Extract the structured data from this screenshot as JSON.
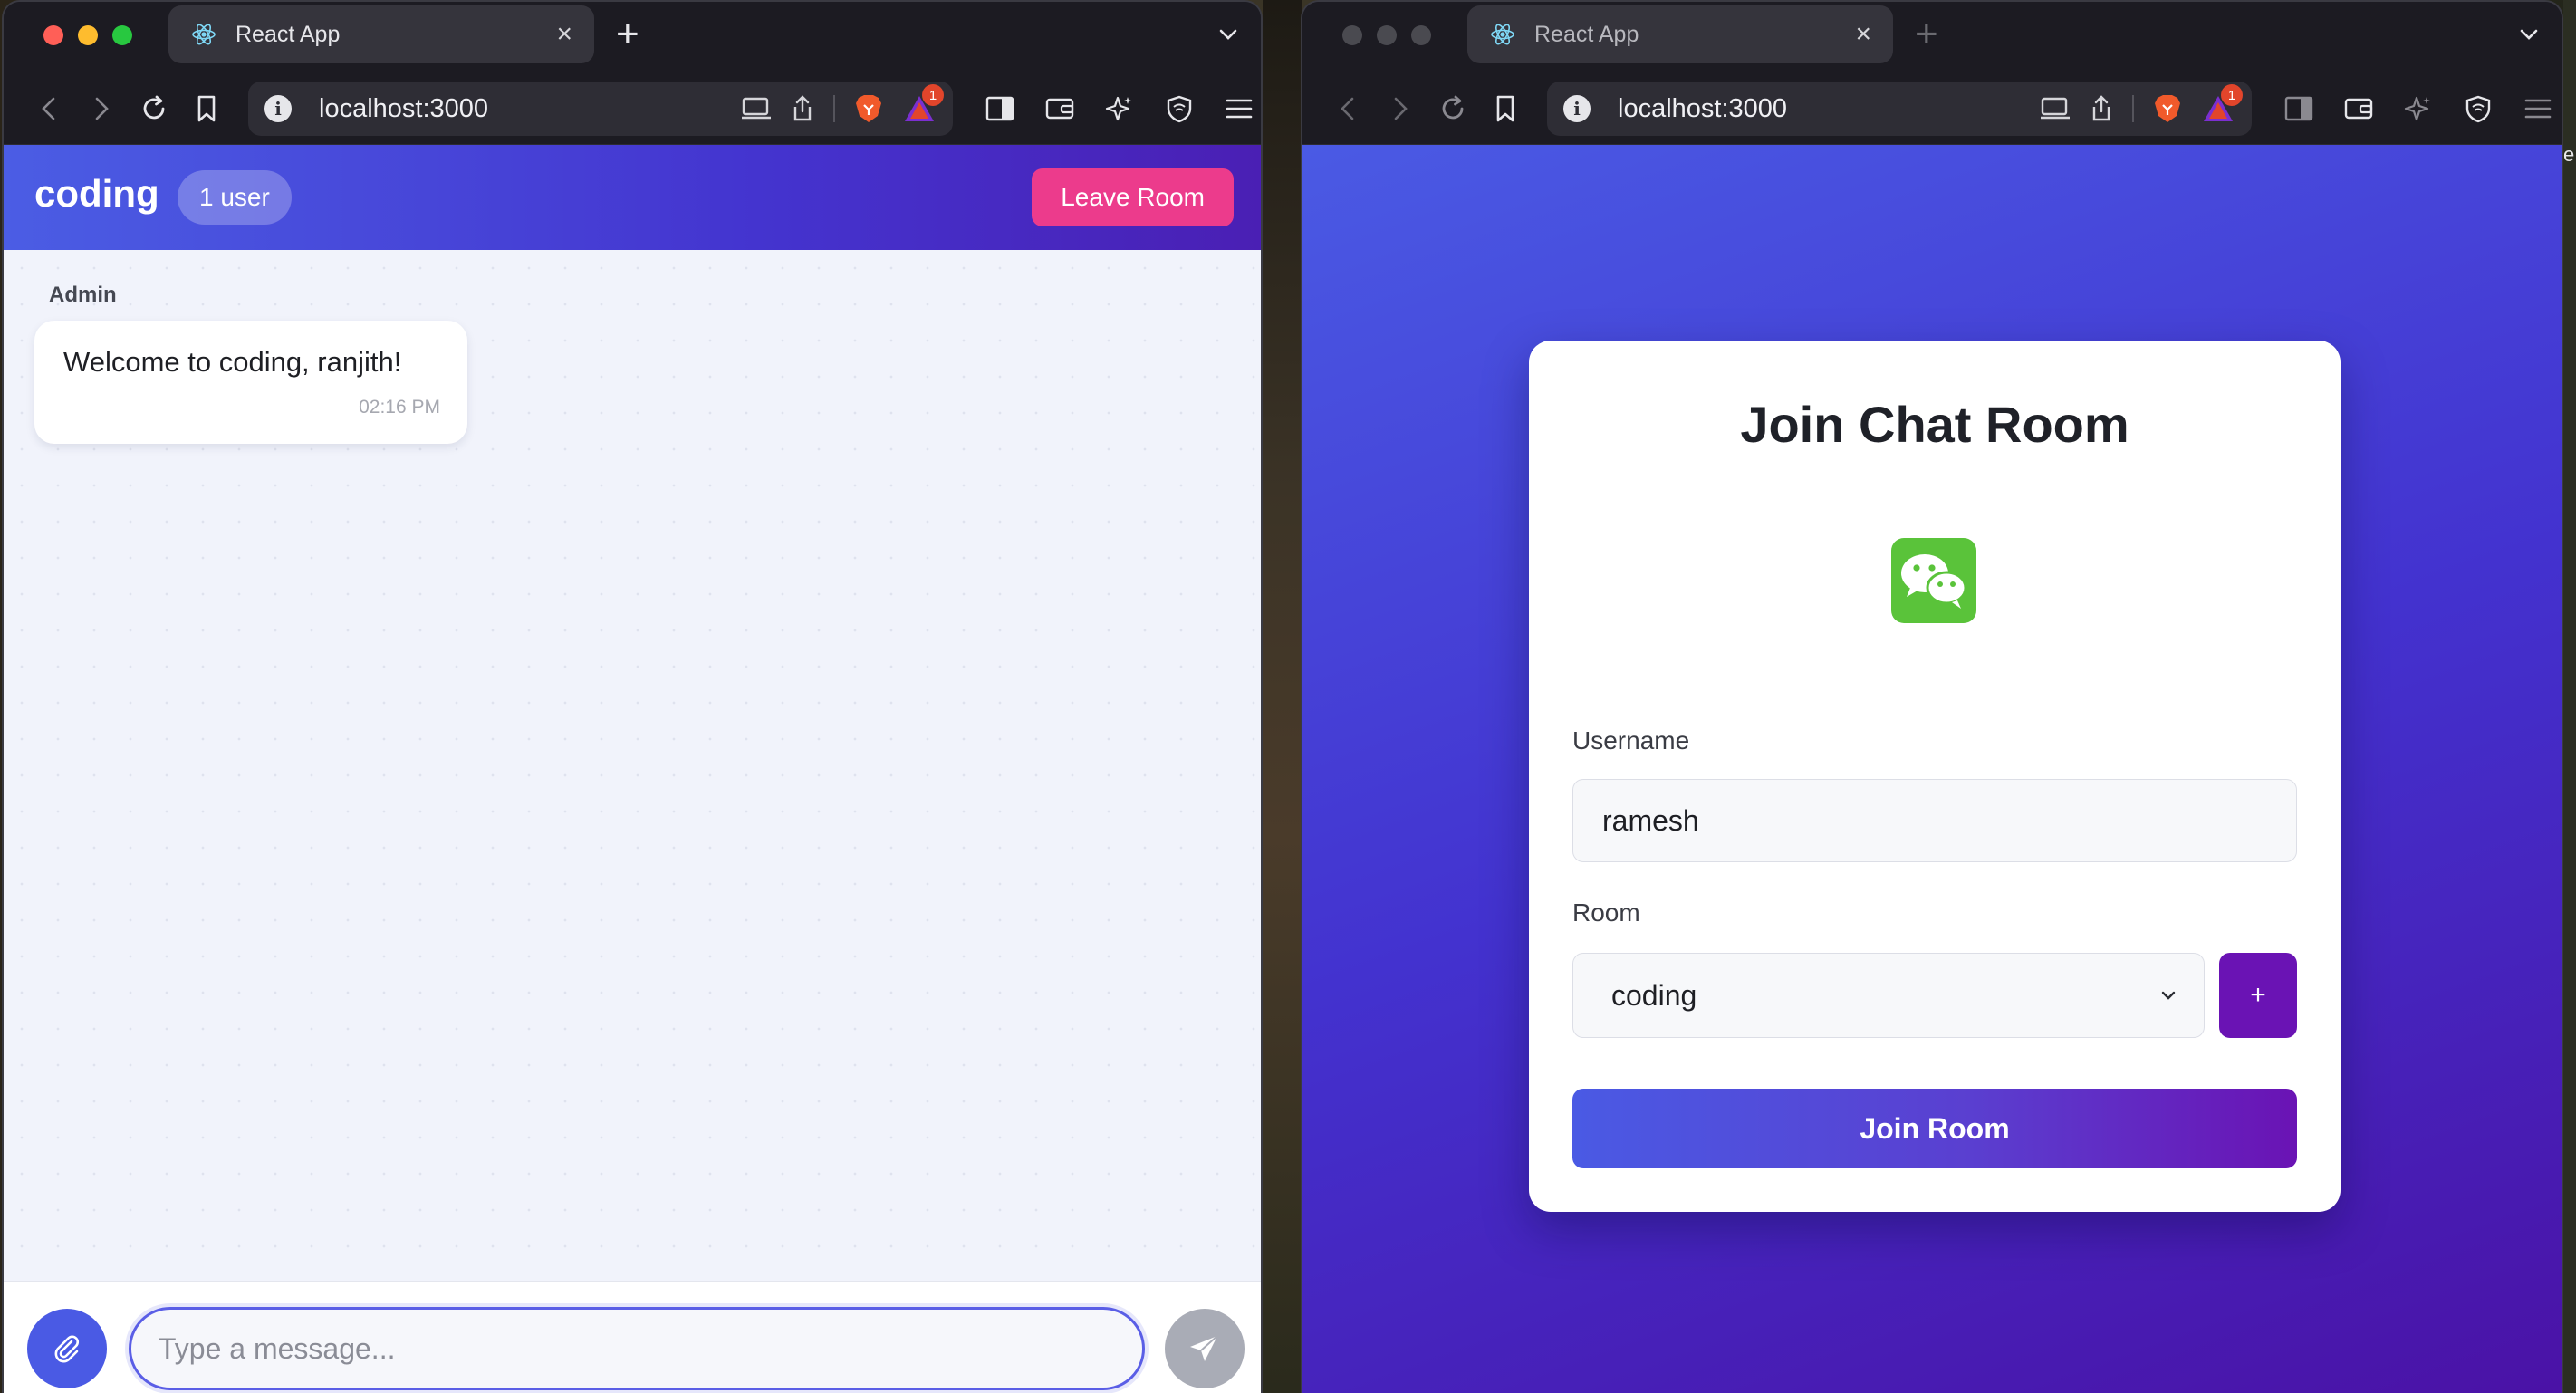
{
  "left_window": {
    "tab": {
      "title": "React App"
    },
    "address": {
      "url": "localhost:3000"
    },
    "chat": {
      "room_name": "coding",
      "user_count": "1 user",
      "leave_button": "Leave Room",
      "messages": [
        {
          "sender": "Admin",
          "text": "Welcome to coding, ranjith!",
          "time": "02:16 PM"
        }
      ],
      "composer": {
        "placeholder": "Type a message...",
        "value": ""
      }
    },
    "badge_count": "1"
  },
  "right_window": {
    "tab": {
      "title": "React App"
    },
    "address": {
      "url": "localhost:3000"
    },
    "join": {
      "title": "Join Chat Room",
      "username_label": "Username",
      "username_value": "ramesh",
      "room_label": "Room",
      "room_selected": "coding",
      "add_room_label": "+",
      "join_button": "Join Room"
    },
    "badge_count": "1"
  },
  "desktop": {
    "edge_letter": "e"
  },
  "colors": {
    "header_gradient_start": "#4b5de4",
    "header_gradient_end": "#4a1fb4",
    "leave_button": "#ec3b8c",
    "add_room_button": "#6a13b4",
    "logo_green": "#5ac33a"
  },
  "icons": {
    "tab_favicon": "react-icon",
    "tab_close": "close-icon",
    "new_tab": "plus-icon",
    "back": "back-icon",
    "forward": "forward-icon",
    "reload": "reload-icon",
    "bookmark": "bookmark-icon",
    "site_info": "info-icon",
    "attach": "paperclip-icon",
    "send": "send-icon",
    "chat_logo": "wechat-icon"
  }
}
